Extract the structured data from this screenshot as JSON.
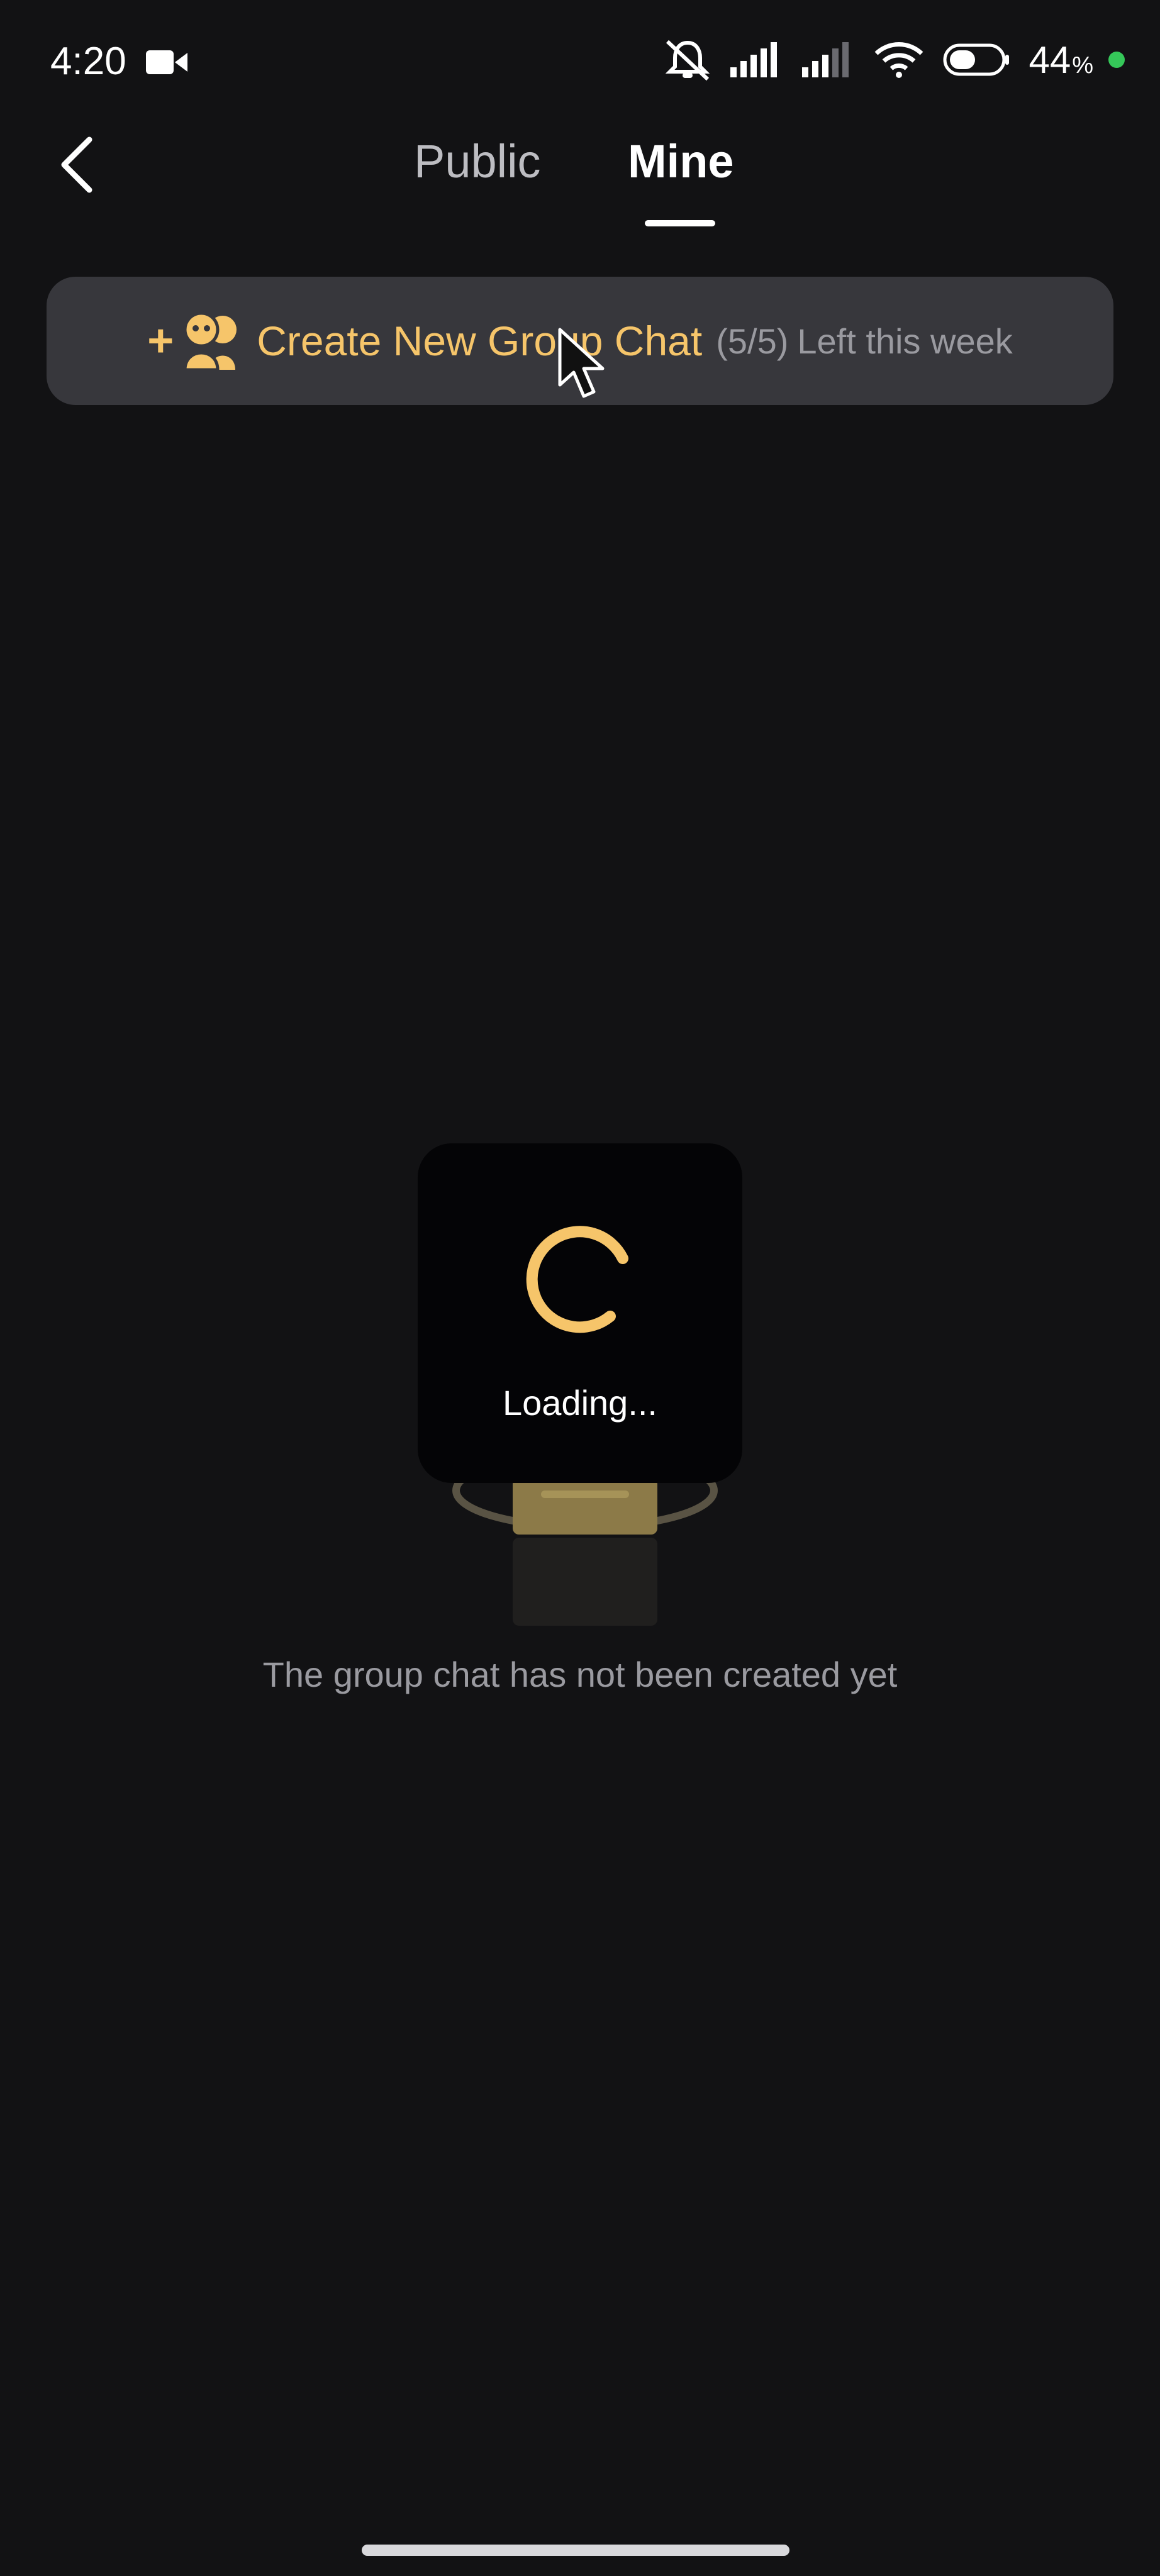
{
  "status_bar": {
    "time": "4:20",
    "battery_level": "44",
    "battery_unit": "%",
    "icons": [
      "video-icon",
      "mute-icon",
      "signal-icon",
      "signal-icon",
      "wifi-icon",
      "battery-icon"
    ]
  },
  "header": {
    "back_icon": "chevron-left-icon",
    "tabs": [
      {
        "label": "Public",
        "active": false
      },
      {
        "label": "Mine",
        "active": true
      }
    ]
  },
  "create_group": {
    "plus": "+",
    "label": "Create New Group Chat",
    "count": "(5/5)",
    "suffix": "Left this week",
    "accent_color": "#f6c56a",
    "icon": "group-chat-icon"
  },
  "empty_state": {
    "message": "The group chat has not been created yet",
    "icon": "empty-box-icon"
  },
  "loading": {
    "text": "Loading...",
    "spinner_color": "#f6c56a"
  },
  "colors": {
    "background": "#121214",
    "card": "#37373c",
    "accent": "#f6c56a",
    "muted_text": "#9a9aa0"
  }
}
